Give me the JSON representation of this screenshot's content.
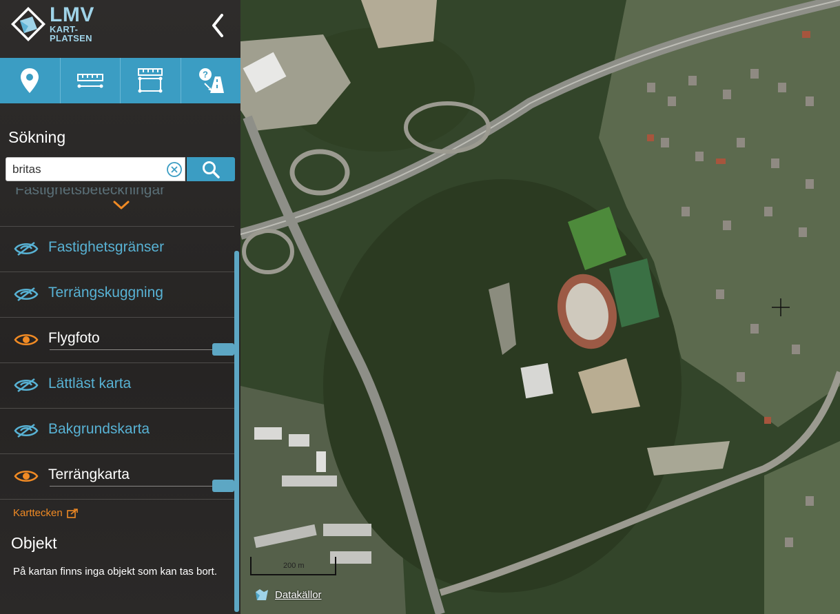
{
  "brand": {
    "logo_big": "LMV",
    "logo_line1": "KART-",
    "logo_line2": "PLATSEN",
    "accent": "#3b9dc3"
  },
  "toolbar": {
    "tools": [
      {
        "icon": "map-pin-icon"
      },
      {
        "icon": "measure-line-icon"
      },
      {
        "icon": "measure-area-icon"
      },
      {
        "icon": "route-help-icon"
      }
    ]
  },
  "search": {
    "title": "Sökning",
    "value": "britas"
  },
  "layers": {
    "hidden_peek": "Fastighetsbeteckningar",
    "items": [
      {
        "name": "Fastighetsgränser",
        "visible": false
      },
      {
        "name": "Terrängskuggning",
        "visible": false
      },
      {
        "name": "Flygfoto",
        "visible": true
      },
      {
        "name": "Lättläst karta",
        "visible": false
      },
      {
        "name": "Bakgrundskarta",
        "visible": false
      },
      {
        "name": "Terrängkarta",
        "visible": true
      }
    ],
    "colors": {
      "visible": "#f08a24",
      "hidden": "#58b2d4"
    }
  },
  "legend": {
    "link": "Karttecken"
  },
  "objects": {
    "title": "Objekt",
    "text": "På kartan finns inga objekt som kan tas bort."
  },
  "map": {
    "scale_label": "200 m",
    "datasources_label": "Datakällor"
  }
}
